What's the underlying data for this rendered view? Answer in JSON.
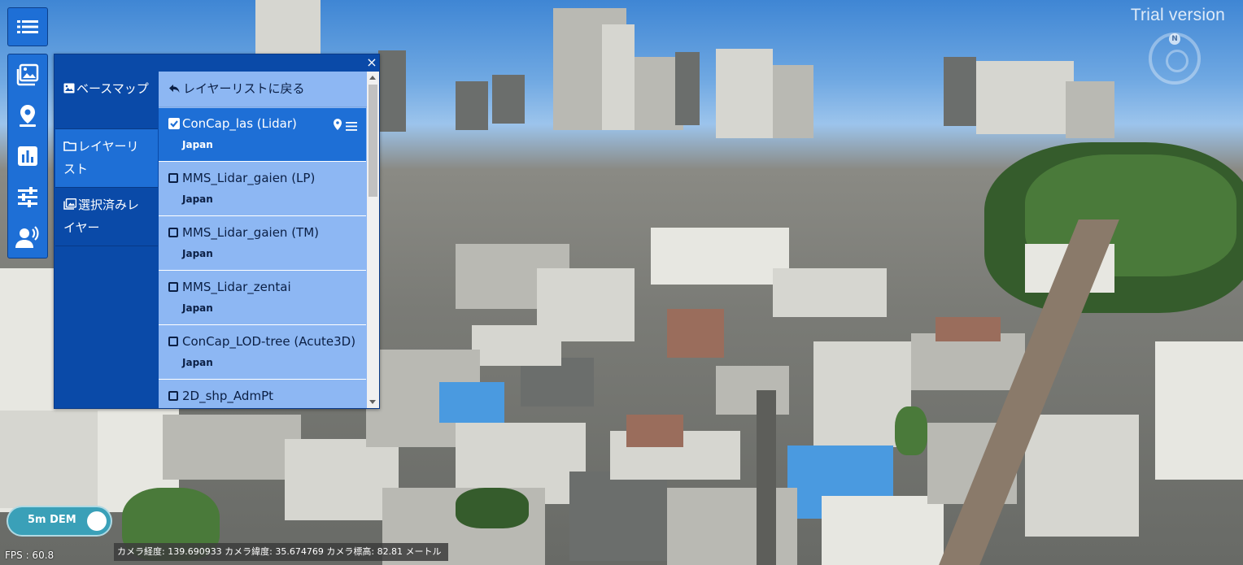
{
  "watermark": "Trial version",
  "compass": {
    "north_label": "N"
  },
  "toolbar": {
    "menu_icon": "list-icon",
    "tools": [
      "layers-icon",
      "location-pin-icon",
      "bar-chart-icon",
      "sliders-icon",
      "speaking-person-icon"
    ]
  },
  "panel": {
    "close_label": "×",
    "nav": [
      {
        "label": "ベースマップ",
        "icon": "image-icon",
        "active": false
      },
      {
        "label": "レイヤーリスト",
        "icon": "folder-icon",
        "active": true
      },
      {
        "label": "選択済みレイヤー",
        "icon": "images-icon",
        "active": false
      }
    ],
    "back_label": "レイヤーリストに戻る",
    "layers": [
      {
        "name": "ConCap_las (Lidar)",
        "region": "Japan",
        "checked": true,
        "selected": true
      },
      {
        "name": "MMS_Lidar_gaien (LP)",
        "region": "Japan",
        "checked": false,
        "selected": false
      },
      {
        "name": "MMS_Lidar_gaien (TM)",
        "region": "Japan",
        "checked": false,
        "selected": false
      },
      {
        "name": "MMS_Lidar_zentai",
        "region": "Japan",
        "checked": false,
        "selected": false
      },
      {
        "name": "ConCap_LOD-tree (Acute3D)",
        "region": "Japan",
        "checked": false,
        "selected": false
      },
      {
        "name": "2D_shp_AdmPt",
        "region": "",
        "checked": false,
        "selected": false
      }
    ]
  },
  "dem": {
    "label": "5m DEM",
    "on": true
  },
  "status": {
    "fps": "FPS : 60.8",
    "camera": "カメラ経度: 139.690933 カメラ緯度: 35.674769 カメラ標高: 82.81 メートル"
  }
}
